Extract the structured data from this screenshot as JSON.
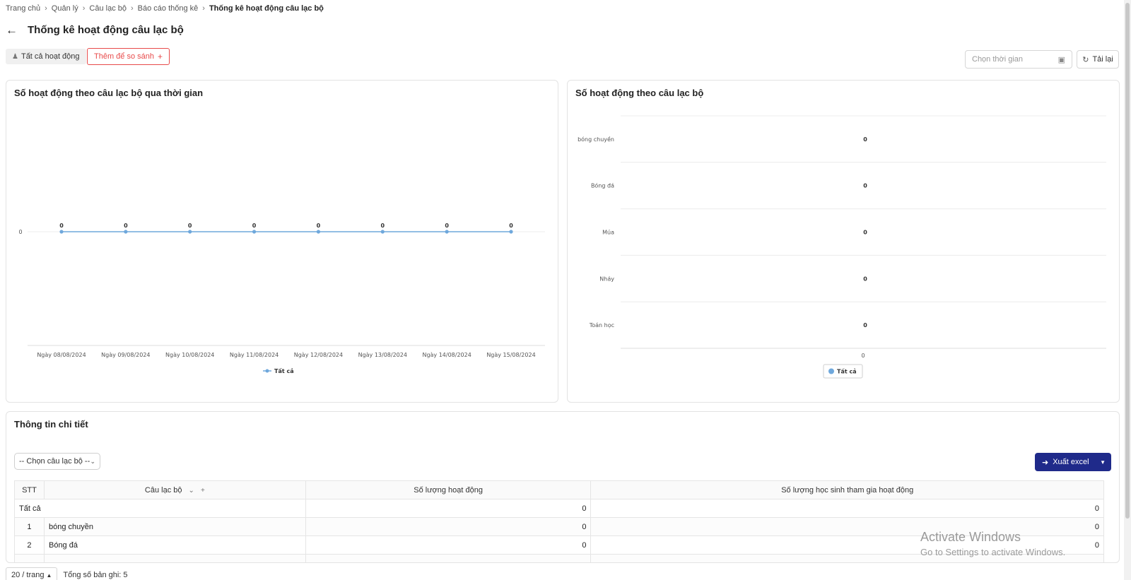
{
  "breadcrumb": {
    "items": [
      "Trang chủ",
      "Quản lý",
      "Câu lạc bộ",
      "Báo cáo thống kê"
    ],
    "current": "Thống kê hoạt động câu lạc bộ"
  },
  "header": {
    "title": "Thống kê hoạt động câu lạc bộ"
  },
  "filters": {
    "all_activities": "Tất cả hoạt động",
    "add_compare": "Thêm để so sánh",
    "date_placeholder": "Chọn thời gian",
    "reload": "Tải lại"
  },
  "colors": {
    "accent_red": "#e84a4a",
    "series_blue": "#6fa8dc",
    "export_button": "#1f2a8a"
  },
  "icons": {
    "back": "arrow-left-icon",
    "user": "user-icon",
    "plus": "plus-icon",
    "calendar": "calendar-icon",
    "reload": "reload-icon",
    "export": "export-icon"
  },
  "chart_data": [
    {
      "type": "line",
      "title": "Số hoạt động theo câu lạc bộ qua thời gian",
      "categories": [
        "Ngày 08/08/2024",
        "Ngày 09/08/2024",
        "Ngày 10/08/2024",
        "Ngày 11/08/2024",
        "Ngày 12/08/2024",
        "Ngày 13/08/2024",
        "Ngày 14/08/2024",
        "Ngày 15/08/2024"
      ],
      "series": [
        {
          "name": "Tất cả",
          "values": [
            0,
            0,
            0,
            0,
            0,
            0,
            0,
            0
          ]
        }
      ],
      "y_ticks": [
        "0"
      ],
      "ylim": [
        0,
        0
      ],
      "legend": "bottom-center",
      "data_labels": true
    },
    {
      "type": "bar",
      "orientation": "horizontal",
      "title": "Số hoạt động theo câu lạc bộ",
      "categories": [
        "bóng chuyền",
        "Bóng đá",
        "Múa",
        "Nhảy",
        "Toán học"
      ],
      "series": [
        {
          "name": "Tất cả",
          "values": [
            0,
            0,
            0,
            0,
            0
          ]
        }
      ],
      "x_ticks": [
        "0"
      ],
      "legend": "bottom-center",
      "data_labels": true
    }
  ],
  "detail": {
    "title": "Thông tin chi tiết",
    "club_select": "-- Chọn câu lạc bộ --",
    "export_label": "Xuất excel",
    "columns": {
      "stt": "STT",
      "club": "Câu lạc bộ",
      "activities": "Số lượng hoạt động",
      "students": "Số lượng học sinh tham gia hoạt động"
    },
    "total_row": {
      "label": "Tất cả",
      "activities": "0",
      "students": "0"
    },
    "rows": [
      {
        "stt": "1",
        "club": "bóng chuyền",
        "activities": "0",
        "students": "0"
      },
      {
        "stt": "2",
        "club": "Bóng đá",
        "activities": "0",
        "students": "0"
      }
    ]
  },
  "pagination": {
    "page_size": "20 / trang",
    "total": "Tổng số bản ghi: 5"
  },
  "watermark": {
    "line1": "Activate Windows",
    "line2": "Go to Settings to activate Windows."
  }
}
